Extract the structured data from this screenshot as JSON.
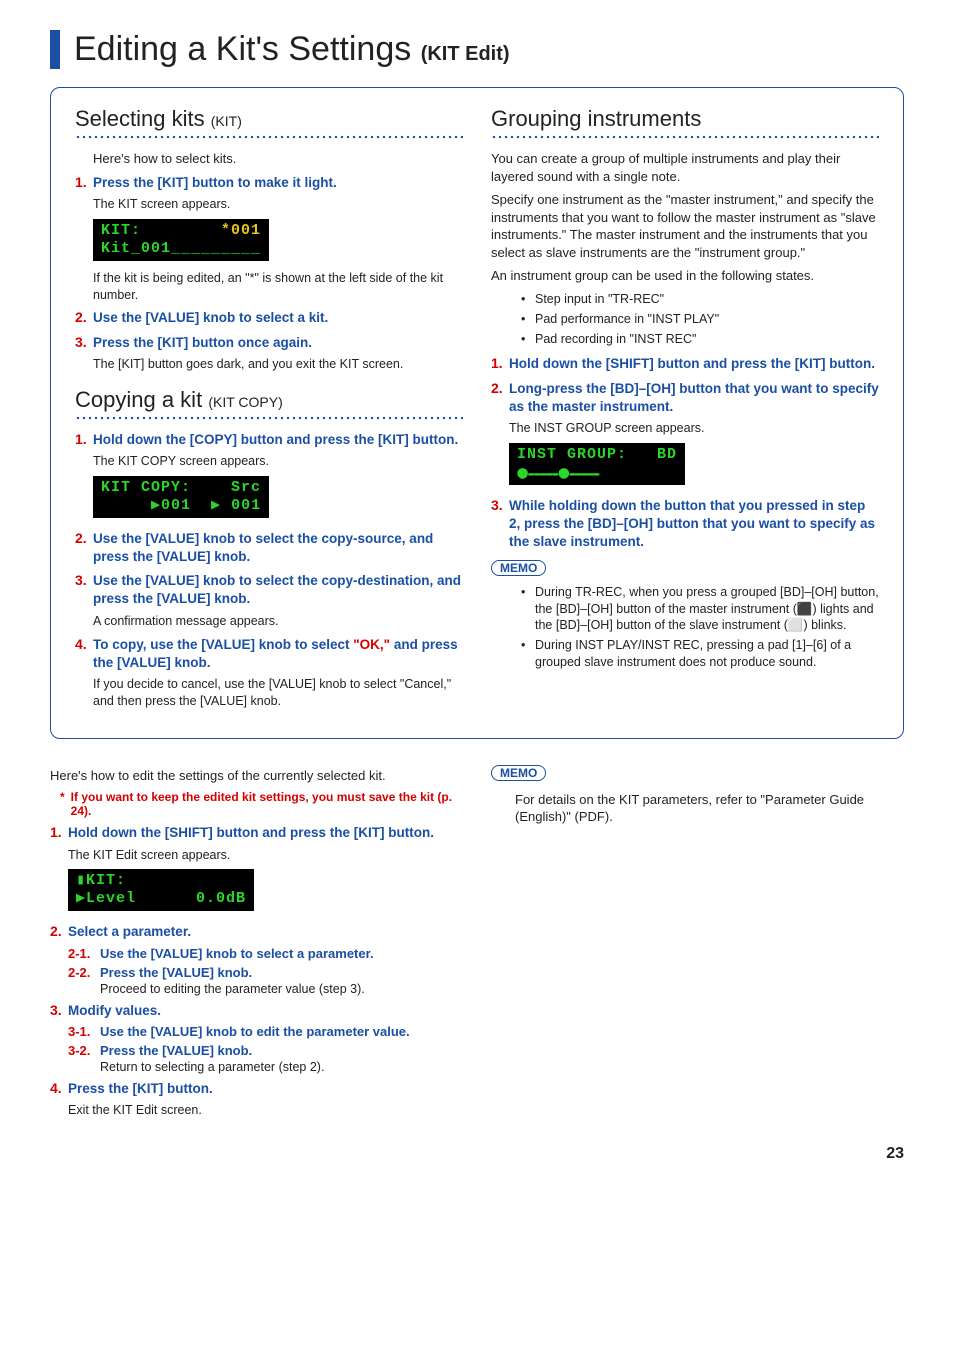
{
  "page": {
    "title_main": "Editing a Kit's Settings",
    "title_sub": "(KIT Edit)",
    "page_number": "23"
  },
  "selecting": {
    "heading": "Selecting kits",
    "heading_paren": "(KIT)",
    "intro": "Here's how to select kits.",
    "step1": "Press the [KIT] button to make it light.",
    "step1_sub": "The KIT screen appears.",
    "lcd_line1": "KIT:        ",
    "lcd_line1_yellow": "*001",
    "lcd_line2": "Kit_001_________",
    "note_after_lcd": "If the kit is being edited, an \"*\" is shown at the left side of the kit number.",
    "step2": "Use the [VALUE] knob to select a kit.",
    "step3": "Press the [KIT] button once again.",
    "step3_sub": "The [KIT] button goes dark, and you exit the KIT screen."
  },
  "copying": {
    "heading": "Copying a kit",
    "heading_paren": "(KIT COPY)",
    "step1": "Hold down the [COPY] button and press the [KIT] button.",
    "step1_sub": "The KIT COPY screen appears.",
    "lcd_line1": "KIT COPY:    Src",
    "lcd_line2": "     ▶001  ▶ 001",
    "step2": "Use the [VALUE] knob to select the copy-source, and press the [VALUE] knob.",
    "step3": "Use the [VALUE] knob to select the copy-destination, and press the [VALUE] knob.",
    "step3_sub": "A confirmation message appears.",
    "step4_a": "To copy, use the [VALUE] knob to select ",
    "step4_ok": "\"OK,\"",
    "step4_b": " and press the [VALUE] knob.",
    "step4_sub": "If you decide to cancel, use the [VALUE] knob to select \"Cancel,\" and then press the [VALUE] knob."
  },
  "grouping": {
    "heading": "Grouping instruments",
    "p1": "You can create a group of multiple instruments and play their layered sound with a single note.",
    "p2": "Specify one instrument as the \"master instrument,\" and specify the instruments that you want to follow the master instrument as \"slave instruments.\" The master instrument and the instruments that you select as slave instruments are the \"instrument group.\"",
    "p3": "An instrument group can be used in the following states.",
    "bullets1": [
      "Step input in \"TR-REC\"",
      "Pad performance in \"INST PLAY\"",
      "Pad recording in \"INST REC\""
    ],
    "step1": "Hold down the [SHIFT] button and press the [KIT] button.",
    "step2": "Long-press the [BD]–[OH] button that you want to specify as the master instrument.",
    "step2_sub": "The INST GROUP screen appears.",
    "lcd_line1": "INST GROUP:   BD",
    "lcd_line2": "⬤▬▬▬▬▬⬤▬▬▬▬▬",
    "step3": "While holding down the button that you pressed in step 2, press the [BD]–[OH] button that you want to specify as the slave instrument.",
    "memo_label": "MEMO",
    "memo_items": [
      "During TR-REC, when you press a grouped [BD]–[OH] button, the [BD]–[OH] button of the master instrument (⬛) lights and the [BD]–[OH] button of the slave instrument (⬜) blinks.",
      "During INST PLAY/INST REC, pressing a pad [1]–[6] of a grouped slave instrument does not produce sound."
    ]
  },
  "editing": {
    "intro": "Here's how to edit the settings of the currently selected kit.",
    "asterisk_note": "If you want to keep the edited kit settings, you must save the kit (p. 24).",
    "step1": "Hold down the [SHIFT] button and press the [KIT] button.",
    "step1_sub": "The KIT Edit screen appears.",
    "lcd_line1": "▮KIT:",
    "lcd_line2": "▶Level      0.0dB",
    "step2": "Select a parameter.",
    "s2_1": "Use the [VALUE] knob to select a parameter.",
    "s2_2": "Press the [VALUE] knob.",
    "s2_2_sub": "Proceed to editing the parameter value (step 3).",
    "step3": "Modify values.",
    "s3_1": "Use the [VALUE] knob to edit the parameter value.",
    "s3_2": "Press the [VALUE] knob.",
    "s3_2_sub": "Return to selecting a parameter (step 2).",
    "step4": "Press the [KIT] button.",
    "step4_sub": "Exit the KIT Edit screen.",
    "memo_label": "MEMO",
    "memo_text": "For details on the KIT parameters, refer to \"Parameter Guide (English)\" (PDF)."
  }
}
